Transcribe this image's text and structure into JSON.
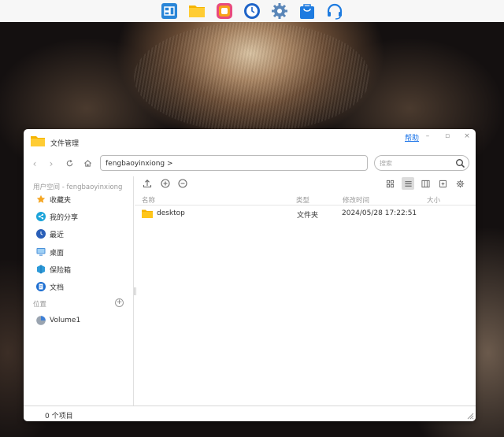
{
  "dock": {
    "items": [
      {
        "name": "desktop-app-icon",
        "color": "#2a86d8"
      },
      {
        "name": "file-manager-icon",
        "color": "#f5b400"
      },
      {
        "name": "photos-icon",
        "color": "#e94b7d"
      },
      {
        "name": "clock-icon",
        "color": "#1f64c8"
      },
      {
        "name": "settings-gear-icon",
        "color": "#5a86b8"
      },
      {
        "name": "app-store-bag-icon",
        "color": "#1e7be0"
      },
      {
        "name": "support-headset-icon",
        "color": "#1e7be0"
      }
    ]
  },
  "window": {
    "title": "文件管理",
    "help": "帮助",
    "controls": {
      "minimize": "–",
      "maximize": "▫",
      "close": "×"
    }
  },
  "toolbar": {
    "path": "fengbaoyinxiong",
    "path_separator": ">",
    "search_placeholder": "搜索"
  },
  "sidebar": {
    "user_space_header": "用户空间 - fengbaoyinxiong",
    "items": [
      {
        "label": "收藏夹",
        "icon": "star-icon"
      },
      {
        "label": "我的分享",
        "icon": "share-icon"
      },
      {
        "label": "最近",
        "icon": "recent-icon"
      },
      {
        "label": "桌面",
        "icon": "desktop-icon"
      },
      {
        "label": "保险箱",
        "icon": "safe-box-icon"
      },
      {
        "label": "文档",
        "icon": "document-icon"
      }
    ],
    "location_header": "位置",
    "locations": [
      {
        "label": "Volume1",
        "icon": "volume-pie-icon"
      }
    ]
  },
  "file_list": {
    "columns": [
      "名称",
      "类型",
      "修改时间",
      "大小"
    ],
    "rows": [
      {
        "name": "desktop",
        "type": "文件夹",
        "modified": "2024/05/28 17:22:51",
        "size": ""
      }
    ]
  },
  "status": {
    "text": "0 个项目"
  },
  "colors": {
    "accent": "#1a73e8",
    "folder": "#f5b400"
  }
}
